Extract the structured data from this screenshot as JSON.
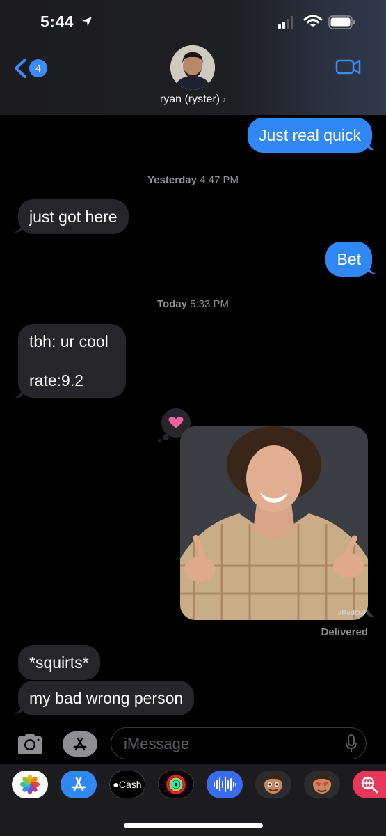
{
  "status_bar": {
    "time": "5:44"
  },
  "header": {
    "back_badge": "4",
    "contact_name": "ryan (ryster)",
    "chevron": "›"
  },
  "messages": [
    {
      "side": "out",
      "text": "Just real quick"
    },
    {
      "type": "timestamp",
      "day": "Yesterday",
      "time": "4:47 PM"
    },
    {
      "side": "in",
      "text": "just got here"
    },
    {
      "side": "out",
      "text": "Bet"
    },
    {
      "type": "timestamp",
      "day": "Today",
      "time": "5:33 PM"
    },
    {
      "side": "in",
      "lines": [
        "tbh: ur cool",
        "",
        "rate:9.2"
      ]
    },
    {
      "side": "out",
      "type": "image",
      "reaction": "heart-icon",
      "watermark": "#RedOak"
    },
    {
      "side": "in",
      "text": "*squirts*"
    },
    {
      "side": "in",
      "text": "my bad wrong person"
    }
  ],
  "delivery_status": "Delivered",
  "input": {
    "placeholder": "iMessage"
  },
  "apps": {
    "cash_label": "Cash"
  },
  "colors": {
    "outgoing_bubble": "#2f88f6",
    "incoming_bubble": "#26252a",
    "accent": "#3a8bfd"
  }
}
